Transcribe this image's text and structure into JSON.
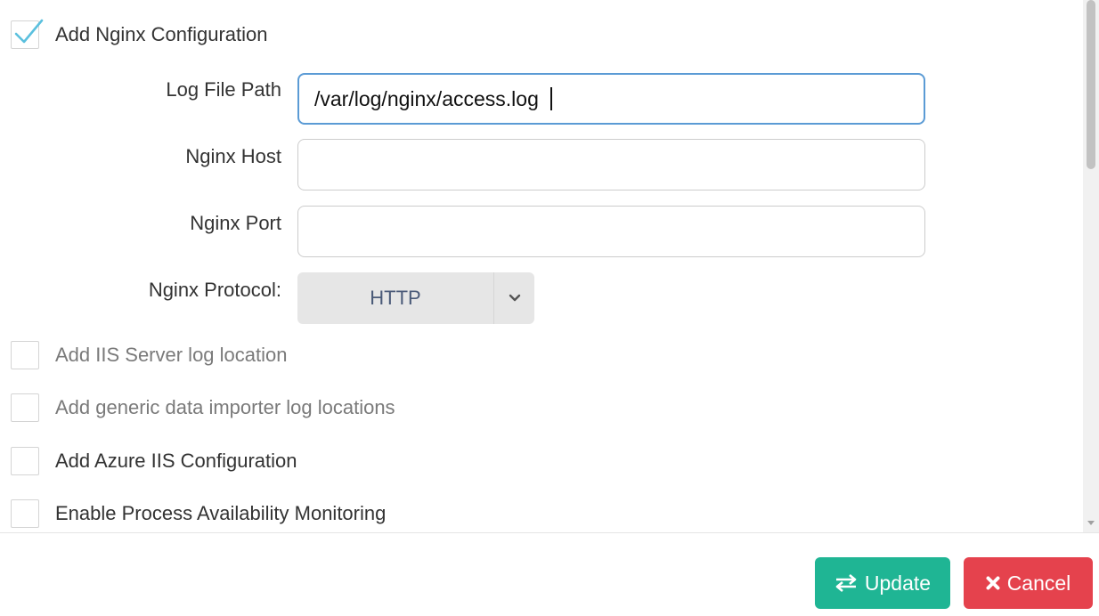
{
  "nginx": {
    "checkbox_label": "Add Nginx Configuration",
    "checked": true,
    "log_file_path_label": "Log File Path",
    "log_file_path_value": "/var/log/nginx/access.log",
    "host_label": "Nginx Host",
    "host_value": "",
    "port_label": "Nginx Port",
    "port_value": "",
    "protocol_label": "Nginx Protocol:",
    "protocol_value": "HTTP"
  },
  "options": [
    {
      "label": "Add IIS Server log location",
      "checked": false,
      "enabled": false
    },
    {
      "label": "Add generic data importer log locations",
      "checked": false,
      "enabled": false
    },
    {
      "label": "Add Azure IIS Configuration",
      "checked": false,
      "enabled": true
    },
    {
      "label": "Enable Process Availability Monitoring",
      "checked": false,
      "enabled": true
    }
  ],
  "footer": {
    "update_label": "Update",
    "cancel_label": "Cancel"
  },
  "icons": {
    "check": "check-icon",
    "dropdown": "chevron-down-icon",
    "update": "swap-arrows-icon",
    "cancel": "times-icon"
  },
  "colors": {
    "accent": "#5bc0de",
    "update_button": "#1fb594",
    "cancel_button": "#e5424d",
    "input_focus": "#5b9bd5"
  }
}
